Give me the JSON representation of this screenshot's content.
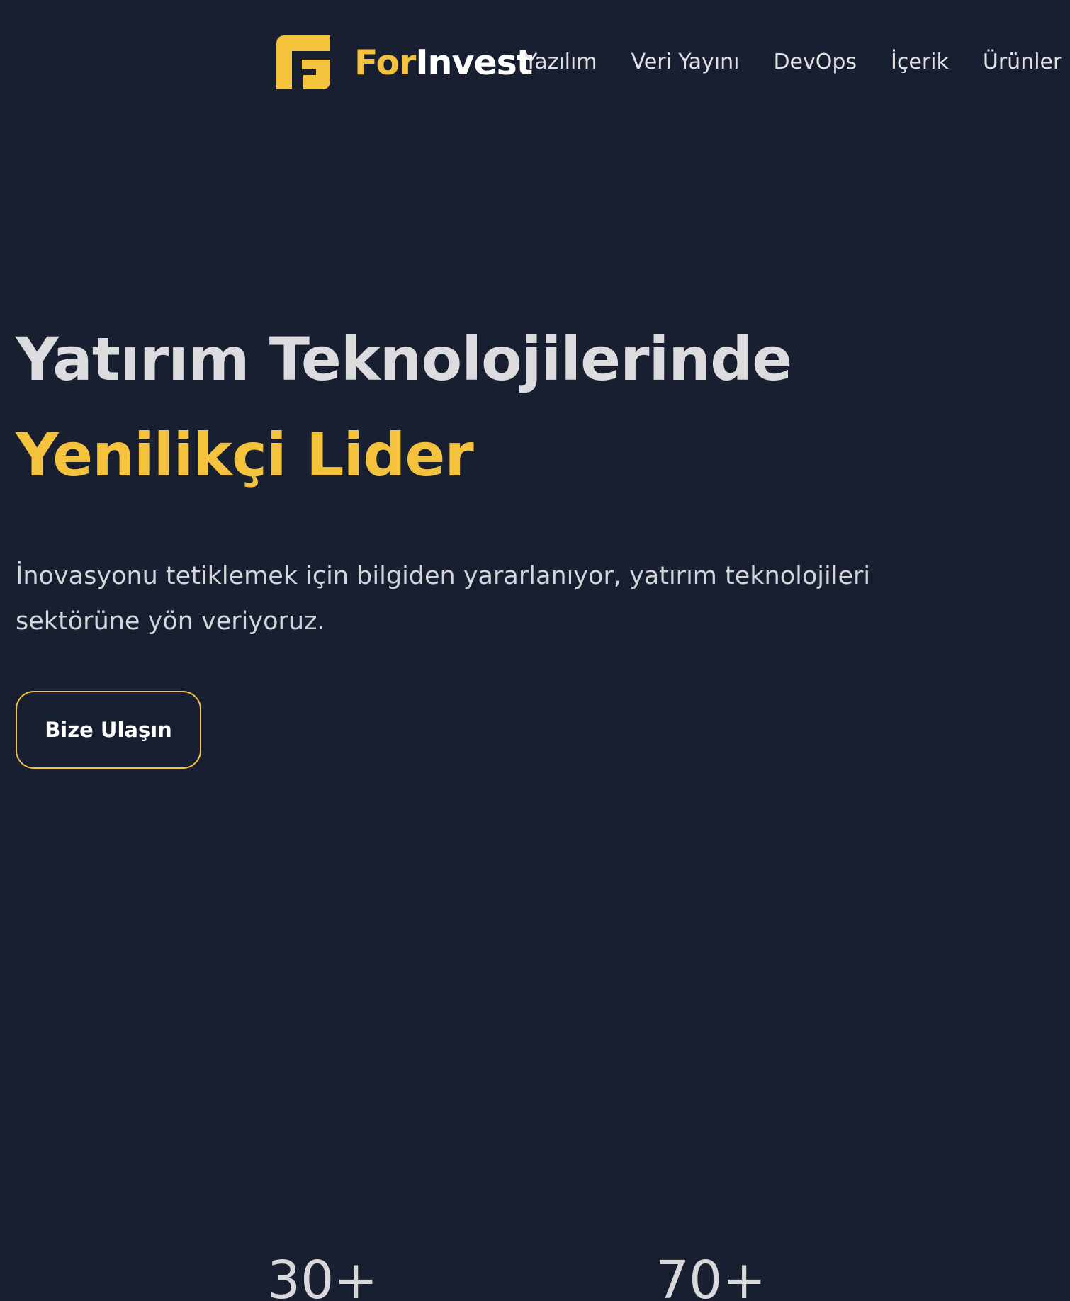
{
  "brand": {
    "name_part1": "For",
    "name_part2": "Invest",
    "accent_color": "#f5c23e",
    "background_color": "#171f31"
  },
  "nav": {
    "items": [
      {
        "label": "Yazılım"
      },
      {
        "label": "Veri Yayını"
      },
      {
        "label": "DevOps"
      },
      {
        "label": "İçerik"
      },
      {
        "label": "Ürünler"
      }
    ]
  },
  "hero": {
    "title_line1": "Yatırım Teknolojilerinde",
    "title_line2": "Yenilikçi Lider",
    "description": "İnovasyonu tetiklemek için bilgiden yararlanıyor, yatırım teknolojileri sektörüne yön veriyoruz.",
    "cta_label": "Bize Ulaşın"
  },
  "stats": [
    {
      "value": "30+"
    },
    {
      "value": "70+"
    }
  ]
}
